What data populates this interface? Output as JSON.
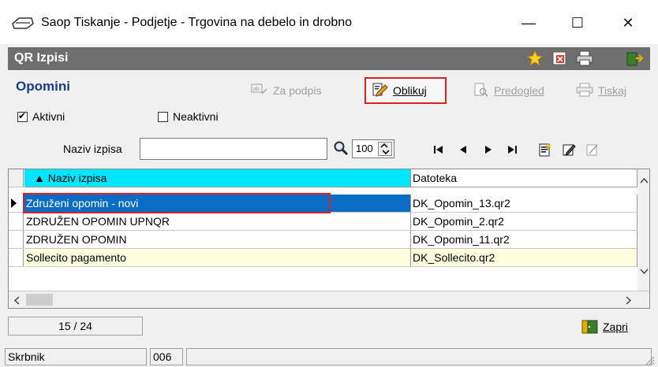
{
  "window": {
    "title": "Saop Tiskanje - Podjetje - Trgovina na debelo in drobno",
    "min_label": "—",
    "max_label": "☐",
    "close_label": "✕"
  },
  "module": {
    "title": "QR Izpisi"
  },
  "toolbar": {
    "section_title": "Opomini",
    "za_podpis_label": "Za podpis",
    "oblikuj_label": "Oblikuj",
    "predogled_label": "Predogled",
    "tiskaj_label": "Tiskaj"
  },
  "filters": {
    "aktivni_label": "Aktivni",
    "aktivni_checked": true,
    "neaktivni_label": "Neaktivni",
    "neaktivni_checked": false
  },
  "search": {
    "label": "Naziv izpisa",
    "value": "",
    "zoom_value": "100"
  },
  "grid": {
    "columns": [
      "▲ Naziv izpisa",
      "Datoteka"
    ],
    "rows": [
      {
        "naziv": "Združeni opomin - novi",
        "datoteka": "DK_Opomin_13.qr2",
        "selected": true
      },
      {
        "naziv": "ZDRUŽEN OPOMIN UPNQR",
        "datoteka": "DK_Opomin_2.qr2",
        "selected": false
      },
      {
        "naziv": "ZDRUŽEN OPOMIN",
        "datoteka": "DK_Opomin_11.qr2",
        "selected": false
      },
      {
        "naziv": "Sollecito pagamento",
        "datoteka": "DK_Sollecito.qr2",
        "selected": false
      }
    ]
  },
  "footer": {
    "counter": "15 / 24",
    "zapri_label": "Zapri"
  },
  "status": {
    "user": "Skrbnik",
    "code": "006"
  },
  "colors": {
    "header_bar": "#6e6e6e",
    "section_title": "#1a3c8c",
    "selected_row": "#0a6cc4",
    "sorted_header": "#00e6ff",
    "highlight_outline": "#e02020",
    "yellow_row": "#ffffe0"
  }
}
